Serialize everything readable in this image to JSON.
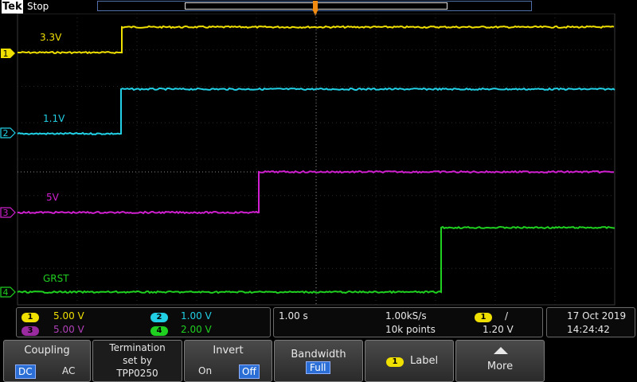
{
  "header": {
    "brand": "Tek",
    "acq_state": "Stop"
  },
  "channels": [
    {
      "id": "1",
      "label": "3.3V",
      "color": "#f0e000",
      "scale": "5.00 V"
    },
    {
      "id": "2",
      "label": "1.1V",
      "color": "#22d0e6",
      "scale": "1.00 V"
    },
    {
      "id": "3",
      "label": "5V",
      "color": "#d020d0",
      "scale": "5.00 V"
    },
    {
      "id": "4",
      "label": "GRST",
      "color": "#20d020",
      "scale": "2.00 V"
    }
  ],
  "timebase": {
    "scale": "1.00 s",
    "sample_rate": "1.00kS/s",
    "record_length": "10k points"
  },
  "trigger": {
    "source": "1",
    "slope_symbol": "/",
    "level": "1.20 V"
  },
  "datetime": {
    "date": "17 Oct  2019",
    "time": "14:24:42"
  },
  "menu": {
    "coupling": {
      "title": "Coupling",
      "options": [
        "DC",
        "AC"
      ],
      "selected": "DC"
    },
    "termination": {
      "line1": "Termination",
      "line2": "set by",
      "line3": "TPP0250"
    },
    "invert": {
      "title": "Invert",
      "options": [
        "On",
        "Off"
      ],
      "selected": "Off"
    },
    "bandwidth": {
      "title": "Bandwidth",
      "value": "Full"
    },
    "label_button": {
      "badge": "1",
      "text": "Label"
    },
    "more": {
      "text": "More"
    }
  }
}
